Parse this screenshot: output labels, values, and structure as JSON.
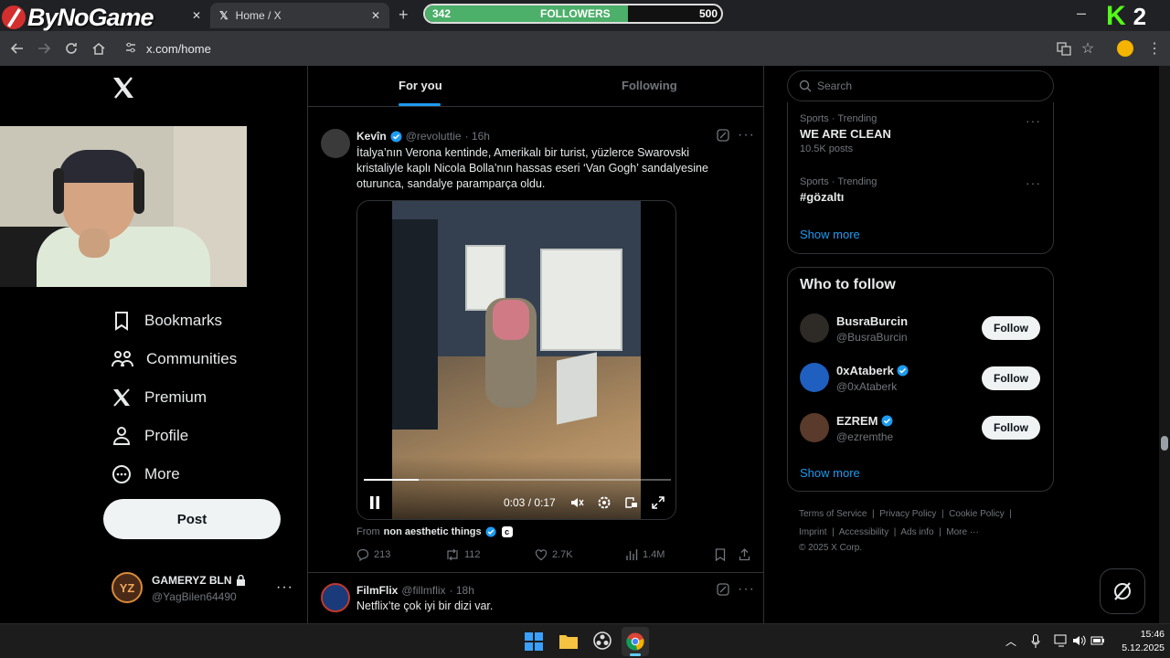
{
  "overlay": {
    "brand": "ByNoGame",
    "followers_label": "FOLLOWERS",
    "followers_current": 342,
    "followers_goal": 500,
    "followers_progress": 0.684,
    "corner_letter": "K",
    "corner_number": "2"
  },
  "browser": {
    "tab_title": "Home / X",
    "url": "x.com/home"
  },
  "nav": {
    "items": [
      {
        "label": "Bookmarks"
      },
      {
        "label": "Communities"
      },
      {
        "label": "Premium"
      },
      {
        "label": "Profile"
      },
      {
        "label": "More"
      }
    ],
    "post_label": "Post"
  },
  "account": {
    "name": "GAMERYZ BLN",
    "handle": "@YagBilen64490",
    "initials": "YZ"
  },
  "feed": {
    "tabs": [
      {
        "label": "For you"
      },
      {
        "label": "Following"
      }
    ],
    "tweet1": {
      "name": "Kevîn",
      "handle": "@revoluttie",
      "time": "· 16h",
      "text": "İtalya’nın Verona kentinde, Amerikalı bir turist, yüzlerce Swarovski kristaliyle kaplı Nicola Bolla’nın hassas eseri ‘Van Gogh’ sandalyesine oturunca, sandalye paramparça oldu.",
      "video_time": "0:03 / 0:17",
      "video_progress": 0.18,
      "from_prefix": "From",
      "from_source": "non aesthetic things",
      "replies": "213",
      "reposts": "112",
      "likes": "2.7K",
      "views": "1.4M"
    },
    "tweet2": {
      "name": "FilmFlix",
      "handle": "@fillmflix",
      "time": "· 18h",
      "text": "Netflix’te çok iyi bir dizi var."
    }
  },
  "sidebar": {
    "search_placeholder": "Search",
    "trends": [
      {
        "category": "Sports · Trending",
        "title": "WE ARE CLEAN",
        "posts": "10.5K posts"
      },
      {
        "category": "Sports · Trending",
        "title": "#gözaltı",
        "posts": ""
      }
    ],
    "show_more": "Show more",
    "who_to_follow_title": "Who to follow",
    "who_to_follow": [
      {
        "name": "BusraBurcin",
        "handle": "@BusraBurcin",
        "verified": false,
        "button": "Follow"
      },
      {
        "name": "0xAtaberk",
        "handle": "@0xAtaberk",
        "verified": true,
        "button": "Follow"
      },
      {
        "name": "EZREM",
        "handle": "@ezremthe",
        "verified": true,
        "button": "Follow"
      }
    ],
    "footer": {
      "l1": [
        "Terms of Service",
        "Privacy Policy",
        "Cookie Policy"
      ],
      "l2": [
        "Imprint",
        "Accessibility",
        "Ads info",
        "More ···"
      ],
      "copyright": "© 2025 X Corp."
    }
  },
  "taskbar": {
    "time": "15:46",
    "date": "5.12.2025"
  },
  "colors": {
    "accent": "#1d9bf0",
    "background": "#000000",
    "border": "#2f3336",
    "followers_fill": "#4caf6a"
  }
}
